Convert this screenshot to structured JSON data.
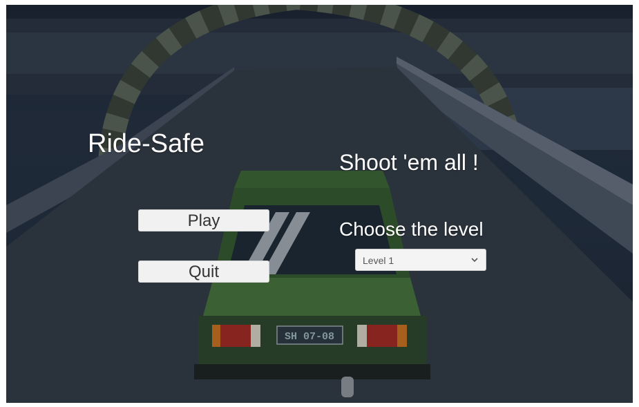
{
  "menu": {
    "title": "Ride-Safe",
    "tagline": "Shoot 'em all !",
    "play_label": "Play",
    "quit_label": "Quit",
    "level_prompt": "Choose the level",
    "level_select": {
      "selected": "Level 1"
    }
  },
  "scene": {
    "license_plate": "SH 07-08",
    "car_color": "#3f6b34",
    "sky_color": "#1f2a38",
    "road_color": "#333c46"
  },
  "icons": {
    "dropdown": "chevron-down-icon"
  }
}
